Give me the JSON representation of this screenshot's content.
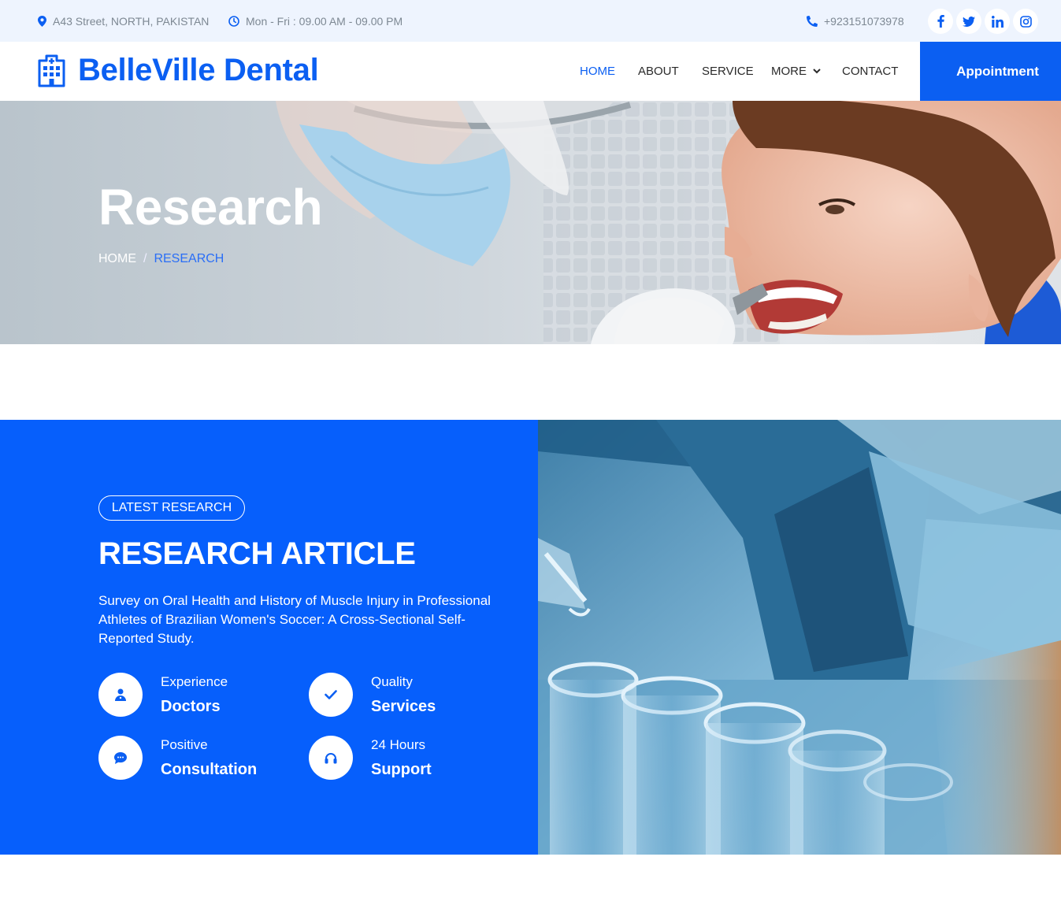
{
  "topbar": {
    "address": "A43 Street, NORTH, PAKISTAN",
    "hours": "Mon - Fri : 09.00 AM - 09.00 PM",
    "phone": "+923151073978",
    "social_icons": [
      "facebook-icon",
      "twitter-icon",
      "linkedin-icon",
      "instagram-icon"
    ]
  },
  "header": {
    "logo": "BelleVille Dental",
    "nav": {
      "home": "HOME",
      "about": "ABOUT",
      "service": "SERVICE",
      "more": "MORE",
      "contact": "CONTACT"
    },
    "appointment": "Appointment"
  },
  "hero": {
    "title": "Research",
    "breadcrumb": {
      "home": "HOME",
      "separator": "/",
      "current": "RESEARCH"
    }
  },
  "research": {
    "badge": "LATEST RESEARCH",
    "title": "RESEARCH ARTICLE",
    "description": "Survey on Oral Health and History of Muscle Injury in Professional Athletes of Brazilian Women's Soccer: A Cross-Sectional Self-Reported Study.",
    "features": [
      {
        "small": "Experience",
        "big": "Doctors",
        "icon": "doctor-icon"
      },
      {
        "small": "Quality",
        "big": "Services",
        "icon": "check-icon"
      },
      {
        "small": "Positive",
        "big": "Consultation",
        "icon": "chat-icon"
      },
      {
        "small": "24 Hours",
        "big": "Support",
        "icon": "headphones-icon"
      }
    ]
  },
  "colors": {
    "primary": "#0b5ff2",
    "section_blue": "#065ffc",
    "topbar_bg": "#eef4fe"
  }
}
